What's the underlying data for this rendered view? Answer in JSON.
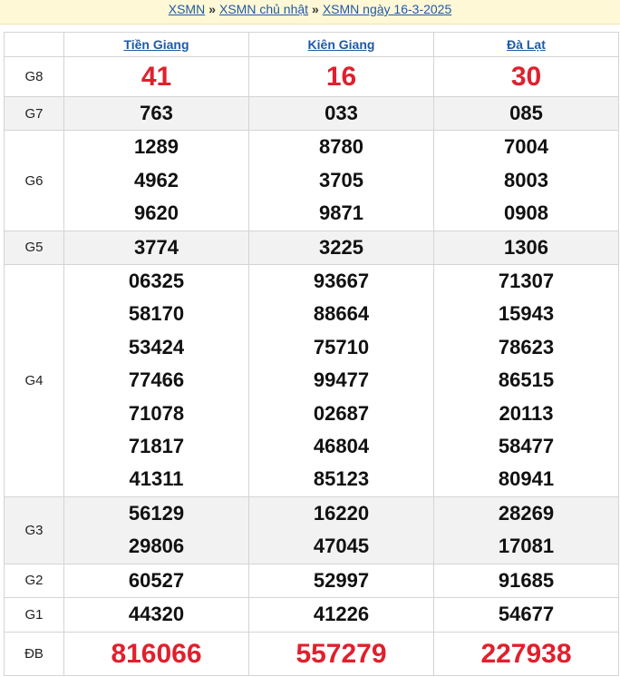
{
  "breadcrumb": {
    "items": [
      "XSMN",
      "XSMN chủ nhật",
      "XSMN ngày 16-3-2025"
    ],
    "separator": "»"
  },
  "header": {
    "provinces": [
      "Tiền Giang",
      "Kiên Giang",
      "Đà Lạt"
    ]
  },
  "prizes": [
    {
      "label": "G8",
      "values": [
        [
          "41"
        ],
        [
          "16"
        ],
        [
          "30"
        ]
      ]
    },
    {
      "label": "G7",
      "values": [
        [
          "763"
        ],
        [
          "033"
        ],
        [
          "085"
        ]
      ]
    },
    {
      "label": "G6",
      "values": [
        [
          "1289",
          "4962",
          "9620"
        ],
        [
          "8780",
          "3705",
          "9871"
        ],
        [
          "7004",
          "8003",
          "0908"
        ]
      ]
    },
    {
      "label": "G5",
      "values": [
        [
          "3774"
        ],
        [
          "3225"
        ],
        [
          "1306"
        ]
      ]
    },
    {
      "label": "G4",
      "values": [
        [
          "06325",
          "58170",
          "53424",
          "77466",
          "71078",
          "71817",
          "41311"
        ],
        [
          "93667",
          "88664",
          "75710",
          "99477",
          "02687",
          "46804",
          "85123"
        ],
        [
          "71307",
          "15943",
          "78623",
          "86515",
          "20113",
          "58477",
          "80941"
        ]
      ]
    },
    {
      "label": "G3",
      "values": [
        [
          "56129",
          "29806"
        ],
        [
          "16220",
          "47045"
        ],
        [
          "28269",
          "17081"
        ]
      ]
    },
    {
      "label": "G2",
      "values": [
        [
          "60527"
        ],
        [
          "52997"
        ],
        [
          "91685"
        ]
      ]
    },
    {
      "label": "G1",
      "values": [
        [
          "44320"
        ],
        [
          "41226"
        ],
        [
          "54677"
        ]
      ]
    },
    {
      "label": "ĐB",
      "values": [
        [
          "816066"
        ],
        [
          "557279"
        ],
        [
          "227938"
        ]
      ]
    }
  ],
  "colors": {
    "accent_red": "#e0202d",
    "link_blue": "#1f5aa6",
    "crumb_bg": "#fff8d6",
    "alt_row_bg": "#f2f2f2"
  }
}
